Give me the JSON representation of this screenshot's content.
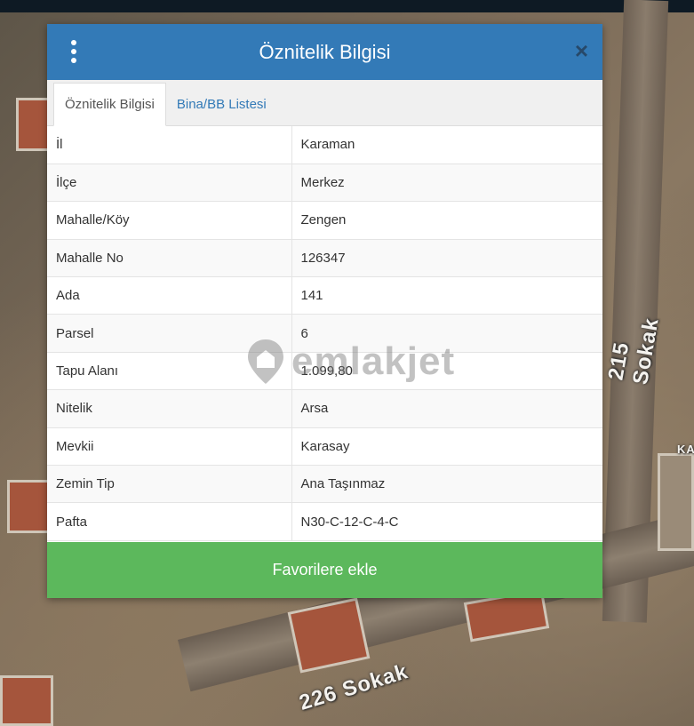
{
  "modal": {
    "title": "Öznitelik Bilgisi",
    "close_label": "×"
  },
  "tabs": [
    {
      "label": "Öznitelik Bilgisi",
      "active": true
    },
    {
      "label": "Bina/BB Listesi",
      "active": false
    }
  ],
  "attributes": [
    {
      "key": "İl",
      "value": "Karaman"
    },
    {
      "key": "İlçe",
      "value": "Merkez"
    },
    {
      "key": "Mahalle/Köy",
      "value": "Zengen"
    },
    {
      "key": "Mahalle No",
      "value": "126347"
    },
    {
      "key": "Ada",
      "value": "141"
    },
    {
      "key": "Parsel",
      "value": "6"
    },
    {
      "key": "Tapu Alanı",
      "value": "1.099,80"
    },
    {
      "key": "Nitelik",
      "value": "Arsa"
    },
    {
      "key": "Mevkii",
      "value": "Karasay"
    },
    {
      "key": "Zemin Tip",
      "value": "Ana Taşınmaz"
    },
    {
      "key": "Pafta",
      "value": "N30-C-12-C-4-C"
    }
  ],
  "favorite_button": "Favorilere ekle",
  "map": {
    "street_labels": [
      "215 Sokak",
      "226 Sokak",
      "KA"
    ]
  },
  "watermark": "emlakjet",
  "colors": {
    "header": "#337ab7",
    "button": "#5cb85c"
  }
}
